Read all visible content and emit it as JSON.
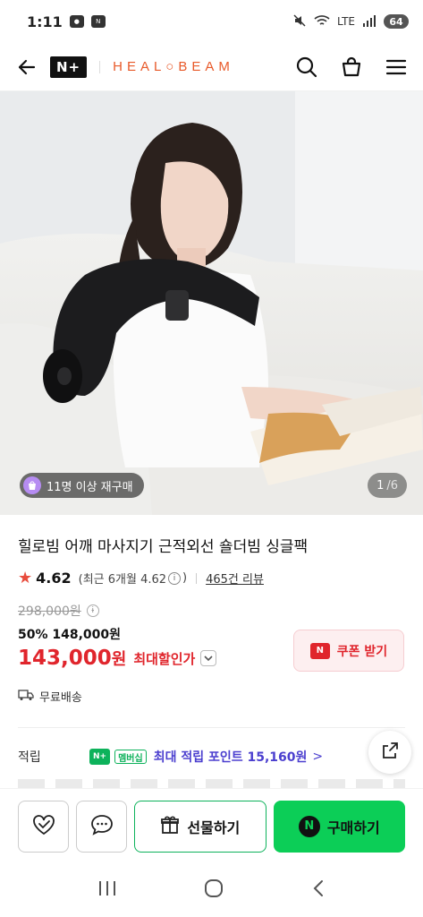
{
  "status_bar": {
    "time": "1:11",
    "battery": "64",
    "network": "LTE"
  },
  "header": {
    "nplus_label": "N+",
    "brand": "HEAL○BEAM"
  },
  "hero": {
    "repurchase_badge": "11명 이상 재구매",
    "pager_current": "1",
    "pager_total": "/6"
  },
  "product": {
    "title": "힐로빔 어깨 마사지기 근적외선 숄더빔 싱글팩",
    "rating": "4.62",
    "recent_rating": "(최근 6개월 4.62",
    "recent_rating_close": ")",
    "review_count": "465건 리뷰",
    "original_price": "298,000원",
    "discount_line": "50% 148,000원",
    "final_price": "143,000",
    "final_unit": "원",
    "max_discount": "최대할인가",
    "coupon_label": "쿠폰 받기",
    "shipping": "무료배송"
  },
  "points": {
    "label": "적립",
    "badge": "N+",
    "membership": "멤버십",
    "text": "최대 적립 포인트 15,160원",
    "arrow": ">"
  },
  "actions": {
    "gift_label": "선물하기",
    "buy_label": "구매하기",
    "buy_n": "N"
  },
  "colors": {
    "accent_red": "#e0252c",
    "naver_green": "#0cce57",
    "points_purple": "#4b3fcf",
    "brand_orange": "#e85a2a"
  }
}
